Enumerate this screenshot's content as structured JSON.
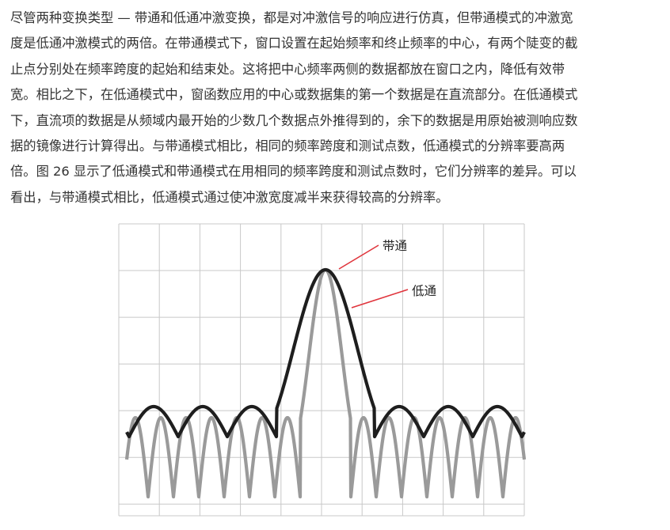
{
  "article": {
    "paragraph_lines": [
      "尽管两种变换类型 — 带通和低通冲激变换，都是对冲激信号的响应进行仿真，但带通模式的冲激宽",
      "度是低通冲激模式的两倍。在带通模式下，窗口设置在起始频率和终止频率的中心，有两个陡变的截",
      "止点分别处在频率跨度的起始和结束处。这将把中心频率两侧的数据都放在窗口之内，降低有效带",
      "宽。相比之下，在低通模式中，窗函数应用的中心或数据集的第一个数据是在直流部分。在低通模式",
      "下，直流项的数据是从频域内最开始的少数几个数据点外推得到的，余下的数据是用原始被测响应数",
      "据的镜像进行计算得出。与带通模式相比，相同的频率跨度和测试点数，低通模式的分辨率要高两",
      "倍。图 26 显示了低通模式和带通模式在用相同的频率跨度和测试点数时，它们分辨率的差异。可以",
      "看出，与带通模式相比，低通模式通过使冲激宽度减半来获得较高的分辨率。"
    ]
  },
  "figure": {
    "labels": {
      "bandpass": "带通",
      "lowpass": "低通"
    },
    "colors": {
      "bandpass": "#1e1e1e",
      "lowpass": "#9a9a9a",
      "annotation_line": "#e0343c",
      "grid": "#c8c8c8"
    }
  }
}
